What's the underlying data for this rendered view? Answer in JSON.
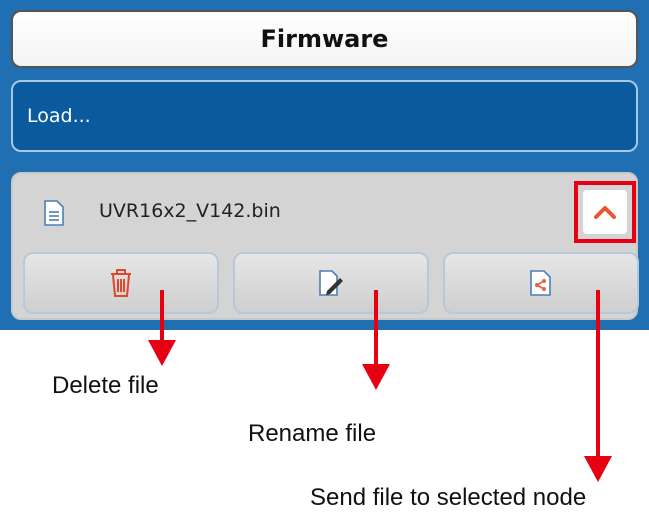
{
  "header": {
    "title": "Firmware"
  },
  "load": {
    "label": "Load..."
  },
  "file": {
    "name": "UVR16x2_V142.bin"
  },
  "actions": [
    {
      "id": "delete",
      "icon": "trash-icon",
      "color": "#e0472f"
    },
    {
      "id": "rename",
      "icon": "edit-document-icon",
      "color": "#333333"
    },
    {
      "id": "send",
      "icon": "share-document-icon",
      "color": "#e8623a"
    }
  ],
  "annotations": {
    "delete": "Delete file",
    "rename": "Rename file",
    "send": "Send file to selected node"
  },
  "colors": {
    "screen_bg": "#1f6fb2",
    "accent_red": "#e60012"
  }
}
